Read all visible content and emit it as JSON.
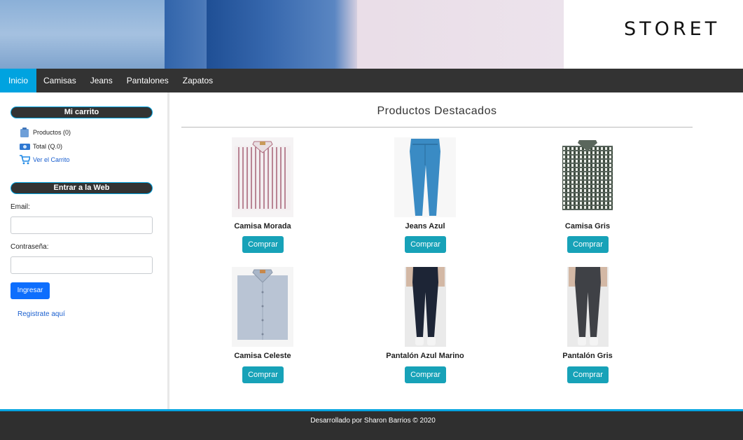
{
  "header": {
    "brand": "STORET"
  },
  "nav": {
    "items": [
      {
        "label": "Inicio",
        "active": true
      },
      {
        "label": "Camisas"
      },
      {
        "label": "Jeans"
      },
      {
        "label": "Pantalones"
      },
      {
        "label": "Zapatos"
      }
    ]
  },
  "sidebar": {
    "cart_title": "Mi carrito",
    "products": "Productos (0)",
    "total": "Total (Q.0)",
    "view_cart": "Ver el Carrito",
    "login_title": "Entrar a la Web",
    "email_label": "Email:",
    "password_label": "Contraseña:",
    "login_button": "Ingresar",
    "register_link": "Registrate aquí"
  },
  "main": {
    "title": "Productos Destacados",
    "buy_label": "Comprar",
    "products": [
      {
        "name": "Camisa Morada"
      },
      {
        "name": "Jeans Azul"
      },
      {
        "name": "Camisa Gris"
      },
      {
        "name": "Camisa Celeste"
      },
      {
        "name": "Pantalón Azul Marino"
      },
      {
        "name": "Pantalón Gris"
      }
    ]
  },
  "footer": {
    "text": "Desarrollado por Sharon Barrios © 2020"
  },
  "colors": {
    "accent": "#00a3e0",
    "buy": "#17a2b8",
    "login": "#0d6efd",
    "nav": "#333333"
  }
}
